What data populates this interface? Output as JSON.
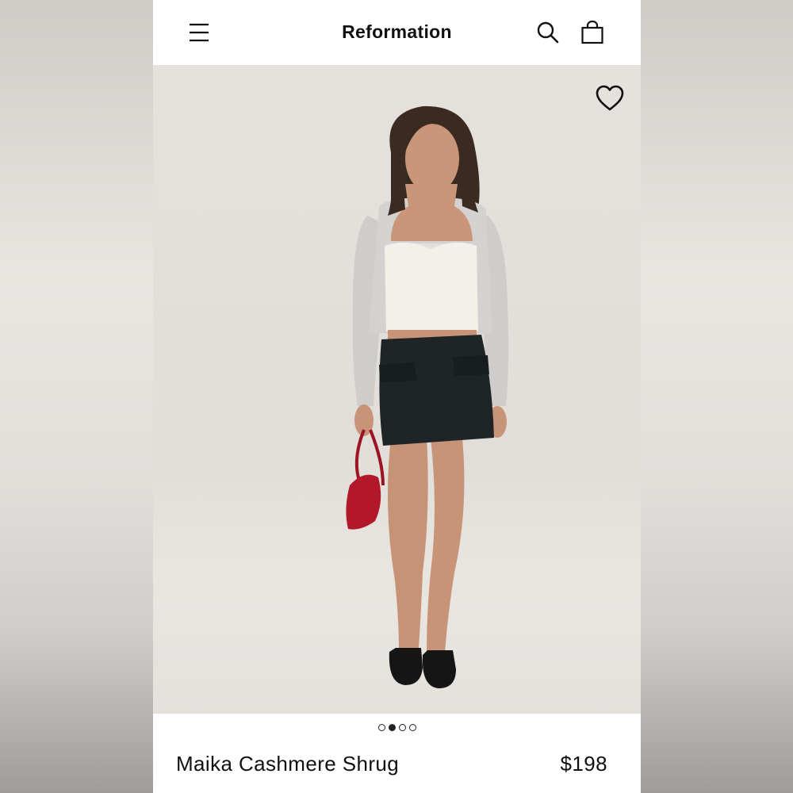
{
  "header": {
    "brand": "Reformation",
    "menu_icon": "hamburger-menu-icon",
    "search_icon": "search-icon",
    "bag_icon": "shopping-bag-icon"
  },
  "hero": {
    "favorite_icon": "heart-outline-icon",
    "image_description_icon": "product-photo"
  },
  "carousel": {
    "total": 4,
    "active_index": 1
  },
  "product": {
    "name": "Maika Cashmere Shrug",
    "price": "$198"
  },
  "colors": {
    "text": "#111111",
    "background": "#ffffff",
    "bag_red": "#b3182a",
    "skirt": "#1f2527",
    "shrug": "#cfcdcb"
  }
}
